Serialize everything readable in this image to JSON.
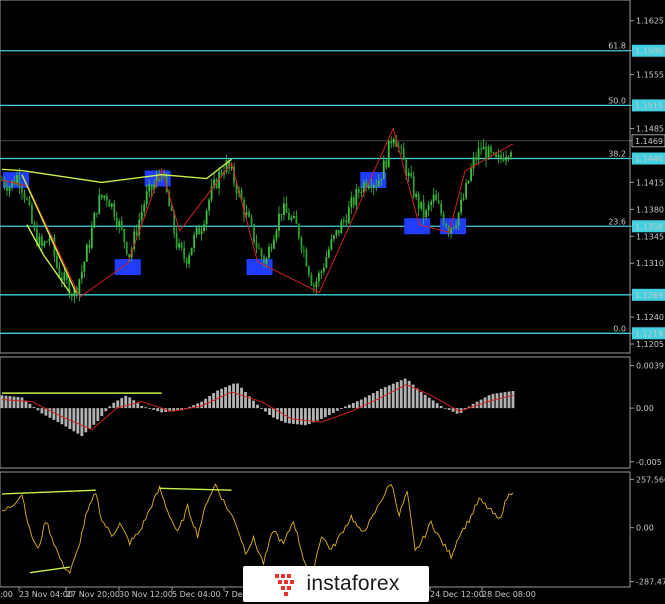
{
  "chart_data": [
    {
      "type": "candlestick",
      "panel": "price",
      "y_ticks": [
        "1.1625",
        "1.1586",
        "1.1555",
        "1.1515",
        "1.1485",
        "1.1469",
        "1.1446",
        "1.1415",
        "1.1380",
        "1.1358",
        "1.1345",
        "1.1310",
        "1.1269",
        "1.1240",
        "1.1219",
        "1.1205"
      ],
      "ylim": [
        1.1196,
        1.1648
      ],
      "highlighted_levels": [
        {
          "value": 1.1586,
          "label": "61.8",
          "tag": "1.1586"
        },
        {
          "value": 1.1515,
          "label": "50.0",
          "tag": "1.1515"
        },
        {
          "value": 1.1446,
          "label": "38.2",
          "tag": "1.1446"
        },
        {
          "value": 1.1358,
          "label": "23.6",
          "tag": "1.1358"
        },
        {
          "value": 1.1269,
          "label": "",
          "tag": "1.1269"
        },
        {
          "value": 1.1219,
          "label": "0.0",
          "tag": "1.1219"
        }
      ],
      "current_price": 1.1469,
      "close_path": [
        [
          0,
          1.1418
        ],
        [
          8,
          1.141
        ],
        [
          16,
          1.1425
        ],
        [
          24,
          1.1395
        ],
        [
          32,
          1.135
        ],
        [
          40,
          1.133
        ],
        [
          48,
          1.1345
        ],
        [
          56,
          1.13
        ],
        [
          64,
          1.1285
        ],
        [
          72,
          1.127
        ],
        [
          80,
          1.13
        ],
        [
          88,
          1.134
        ],
        [
          96,
          1.139
        ],
        [
          104,
          1.14
        ],
        [
          112,
          1.138
        ],
        [
          120,
          1.135
        ],
        [
          128,
          1.132
        ],
        [
          136,
          1.136
        ],
        [
          144,
          1.1395
        ],
        [
          152,
          1.141
        ],
        [
          160,
          1.143
        ],
        [
          168,
          1.138
        ],
        [
          176,
          1.133
        ],
        [
          184,
          1.1315
        ],
        [
          192,
          1.134
        ],
        [
          200,
          1.136
        ],
        [
          208,
          1.1395
        ],
        [
          216,
          1.142
        ],
        [
          224,
          1.144
        ],
        [
          232,
          1.142
        ],
        [
          240,
          1.139
        ],
        [
          248,
          1.136
        ],
        [
          256,
          1.133
        ],
        [
          264,
          1.131
        ],
        [
          272,
          1.135
        ],
        [
          280,
          1.138
        ],
        [
          288,
          1.137
        ],
        [
          296,
          1.1355
        ],
        [
          304,
          1.132
        ],
        [
          312,
          1.128
        ],
        [
          320,
          1.13
        ],
        [
          328,
          1.133
        ],
        [
          336,
          1.135
        ],
        [
          344,
          1.137
        ],
        [
          352,
          1.139
        ],
        [
          360,
          1.141
        ],
        [
          368,
          1.142
        ],
        [
          376,
          1.1415
        ],
        [
          384,
          1.144
        ],
        [
          392,
          1.1482
        ],
        [
          400,
          1.145
        ],
        [
          408,
          1.142
        ],
        [
          416,
          1.139
        ],
        [
          424,
          1.137
        ],
        [
          432,
          1.1395
        ],
        [
          440,
          1.1375
        ],
        [
          448,
          1.1355
        ],
        [
          456,
          1.137
        ],
        [
          464,
          1.14
        ],
        [
          472,
          1.144
        ],
        [
          480,
          1.146
        ],
        [
          488,
          1.145
        ],
        [
          496,
          1.144
        ],
        [
          504,
          1.1455
        ],
        [
          512,
          1.1465
        ]
      ],
      "zigzag": [
        [
          0,
          1.1418
        ],
        [
          26,
          1.141
        ],
        [
          78,
          1.1266
        ],
        [
          126,
          1.131
        ],
        [
          160,
          1.1432
        ],
        [
          178,
          1.1352
        ],
        [
          230,
          1.144
        ],
        [
          256,
          1.1312
        ],
        [
          318,
          1.1272
        ],
        [
          392,
          1.1485
        ],
        [
          418,
          1.136
        ],
        [
          448,
          1.135
        ],
        [
          464,
          1.143
        ],
        [
          512,
          1.1465
        ]
      ],
      "trendlines": [
        {
          "points": [
            [
              0,
              1.1432
            ],
            [
              22,
              1.143
            ],
            [
              100,
              1.1415
            ],
            [
              160,
              1.1425
            ],
            [
              205,
              1.142
            ],
            [
              230,
              1.1445
            ]
          ]
        },
        {
          "points": [
            [
              25,
              1.136
            ],
            [
              42,
              1.132
            ],
            [
              68,
              1.1272
            ]
          ]
        },
        {
          "points": [
            [
              20,
              1.1425
            ],
            [
              74,
              1.1272
            ]
          ]
        }
      ],
      "marked_boxes": [
        {
          "x": 14,
          "y": 1.1418
        },
        {
          "x": 126,
          "y": 1.1305
        },
        {
          "x": 156,
          "y": 1.142
        },
        {
          "x": 258,
          "y": 1.1305
        },
        {
          "x": 372,
          "y": 1.1418
        },
        {
          "x": 416,
          "y": 1.1358
        },
        {
          "x": 452,
          "y": 1.1358
        }
      ],
      "colors": {
        "up": "#3fbf3f",
        "down": "#2e9e2e",
        "wick": "#3fbf3f",
        "level": "#40d0e0",
        "zigzag": "#d02020",
        "trend": "#c8f04a",
        "box": "#1f3cff"
      }
    },
    {
      "type": "bar",
      "panel": "macd",
      "y_ticks": [
        "0.00397",
        "0.00",
        "-0.005"
      ],
      "ylim": [
        -0.0053,
        0.0043
      ],
      "signal_color": "#d02020",
      "histogram_color": "#b4b4b4",
      "values_path": [
        [
          0,
          0.0012
        ],
        [
          20,
          0.001
        ],
        [
          40,
          -0.0005
        ],
        [
          60,
          -0.0015
        ],
        [
          80,
          -0.0026
        ],
        [
          96,
          -0.0012
        ],
        [
          110,
          0.0004
        ],
        [
          125,
          0.0012
        ],
        [
          140,
          0.0002
        ],
        [
          160,
          -0.0004
        ],
        [
          180,
          -0.0002
        ],
        [
          200,
          0.0006
        ],
        [
          215,
          0.0016
        ],
        [
          235,
          0.0024
        ],
        [
          255,
          0.0004
        ],
        [
          270,
          -0.0008
        ],
        [
          285,
          -0.0014
        ],
        [
          305,
          -0.0016
        ],
        [
          325,
          -0.0008
        ],
        [
          345,
          0.0002
        ],
        [
          360,
          0.0008
        ],
        [
          380,
          0.0018
        ],
        [
          405,
          0.0028
        ],
        [
          420,
          0.0015
        ],
        [
          440,
          0.0002
        ],
        [
          458,
          -0.0006
        ],
        [
          470,
          0.0003
        ],
        [
          490,
          0.0013
        ],
        [
          512,
          0.0016
        ]
      ],
      "signal_path": [
        [
          0,
          0.0008
        ],
        [
          30,
          0.0006
        ],
        [
          60,
          -0.0008
        ],
        [
          90,
          -0.002
        ],
        [
          115,
          0.0
        ],
        [
          140,
          0.0006
        ],
        [
          170,
          -0.0003
        ],
        [
          200,
          0.0002
        ],
        [
          230,
          0.0015
        ],
        [
          260,
          0.0006
        ],
        [
          290,
          -0.001
        ],
        [
          320,
          -0.0013
        ],
        [
          350,
          -0.0003
        ],
        [
          380,
          0.001
        ],
        [
          405,
          0.0022
        ],
        [
          430,
          0.0012
        ],
        [
          458,
          -0.0003
        ],
        [
          490,
          0.0007
        ],
        [
          512,
          0.0012
        ]
      ],
      "divergence_lines": [
        {
          "points": [
            [
              0,
              0.0014
            ],
            [
              160,
              0.0014
            ]
          ]
        }
      ]
    },
    {
      "type": "line",
      "panel": "oscillator",
      "y_ticks": [
        "257.5664",
        "0.00",
        "-287.471"
      ],
      "ylim": [
        -300,
        270
      ],
      "line_color": "#e0b020",
      "values_path": [
        [
          0,
          80
        ],
        [
          10,
          120
        ],
        [
          20,
          180
        ],
        [
          28,
          -20
        ],
        [
          36,
          -120
        ],
        [
          44,
          40
        ],
        [
          52,
          -80
        ],
        [
          60,
          -190
        ],
        [
          68,
          -240
        ],
        [
          76,
          -120
        ],
        [
          84,
          60
        ],
        [
          94,
          190
        ],
        [
          100,
          40
        ],
        [
          110,
          -40
        ],
        [
          118,
          20
        ],
        [
          128,
          -80
        ],
        [
          138,
          -20
        ],
        [
          150,
          120
        ],
        [
          158,
          210
        ],
        [
          166,
          90
        ],
        [
          176,
          -30
        ],
        [
          186,
          110
        ],
        [
          196,
          -40
        ],
        [
          206,
          150
        ],
        [
          214,
          230
        ],
        [
          224,
          120
        ],
        [
          234,
          30
        ],
        [
          244,
          -130
        ],
        [
          252,
          -60
        ],
        [
          262,
          -190
        ],
        [
          272,
          -10
        ],
        [
          282,
          -90
        ],
        [
          292,
          40
        ],
        [
          302,
          -160
        ],
        [
          310,
          -270
        ],
        [
          320,
          -40
        ],
        [
          330,
          -120
        ],
        [
          340,
          -30
        ],
        [
          350,
          60
        ],
        [
          360,
          -30
        ],
        [
          370,
          40
        ],
        [
          380,
          150
        ],
        [
          390,
          240
        ],
        [
          398,
          70
        ],
        [
          406,
          190
        ],
        [
          414,
          -130
        ],
        [
          422,
          -60
        ],
        [
          430,
          30
        ],
        [
          440,
          -70
        ],
        [
          450,
          -150
        ],
        [
          458,
          -40
        ],
        [
          468,
          40
        ],
        [
          478,
          150
        ],
        [
          488,
          100
        ],
        [
          498,
          40
        ],
        [
          506,
          160
        ],
        [
          512,
          200
        ]
      ],
      "trendlines": [
        {
          "points": [
            [
              0,
              180
            ],
            [
              94,
              200
            ]
          ]
        },
        {
          "points": [
            [
              158,
              210
            ],
            [
              230,
              200
            ]
          ]
        },
        {
          "points": [
            [
              28,
              -240
            ],
            [
              68,
              -210
            ]
          ]
        }
      ]
    }
  ],
  "x_axis": {
    "tick_labels": [
      "23 Nov 04:00",
      "27 Nov 20:00",
      "30 Nov 12:00",
      "5 Dec 04:00",
      "7 Dec",
      "24 Dec 12:00",
      "28 Dec 08:00"
    ],
    "leading_fragment": ":00"
  },
  "watermark": {
    "text": "instaforex"
  }
}
